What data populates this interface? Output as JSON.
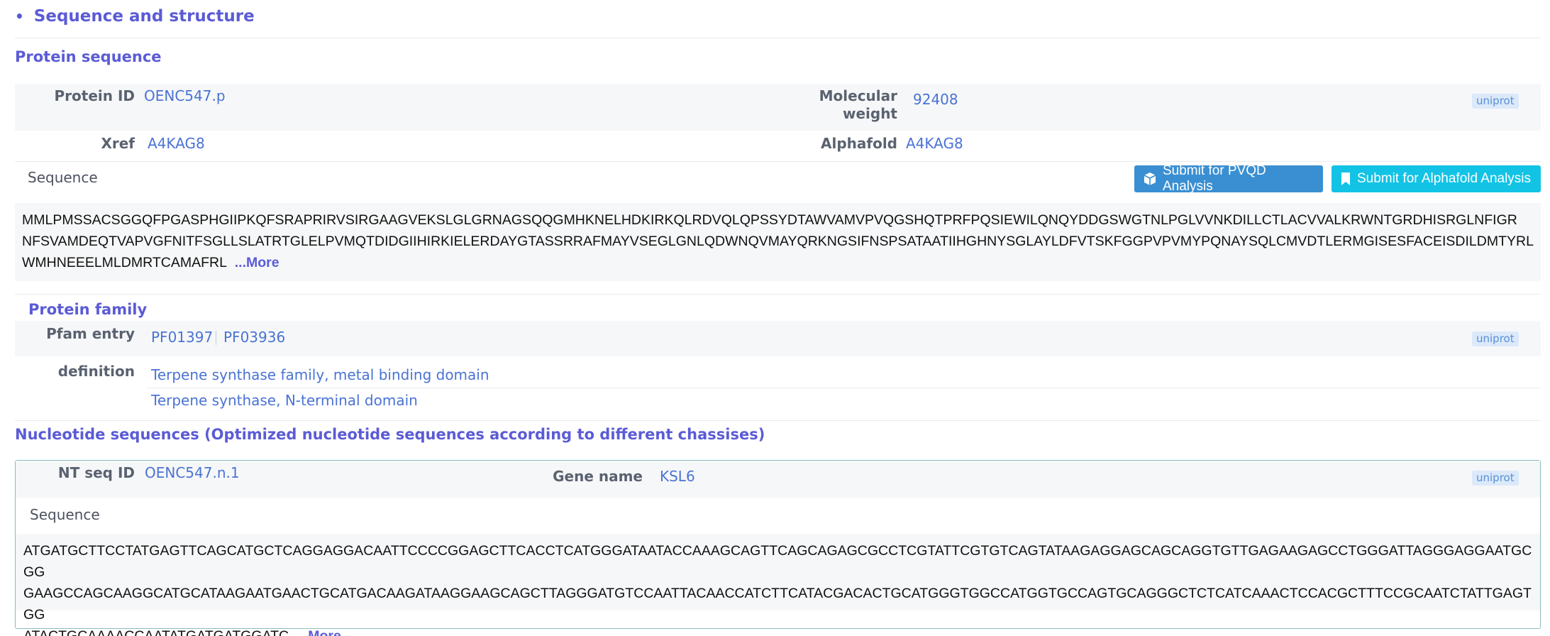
{
  "section": {
    "bullet": "•",
    "title": "Sequence and structure"
  },
  "protein_sequence": {
    "title": "Protein sequence",
    "protein_id_label": "Protein ID",
    "protein_id": "OENC547.p",
    "molecular_weight_label_1": "Molecular",
    "molecular_weight_label_2": "weight",
    "molecular_weight": "92408",
    "source_badge": "uniprot",
    "xref_label": "Xref",
    "xref": "A4KAG8",
    "alphafold_label": "Alphafold",
    "alphafold": "A4KAG8",
    "sequence_label": "Sequence",
    "submit_pvqd": "Submit for PVQD Analysis",
    "submit_alphafold": "Submit for Alphafold Analysis",
    "sequence_line_1": "MMLPMSSACSGGQFPGASPHGIIPKQFSRAPRIRVSIRGAAGVEKSLGLGRNAGSQQGMHKNELHDKIRKQLRDVQLQPSSYDTAWVAMVPVQGSHQTPRFPQSIEWILQNQYDDGSWGTNLPGLVVNKDILLCTLACVVALKRWNTGRDHISRGLNFIGR",
    "sequence_line_2": "NFSVAMDEQTVAPVGFNITFSGLLSLATRTGLELPVMQTDIDGIIHIRKIELERDAYGTASSRRAFMAYVSEGLGNLQDWNQVMAYQRKNGSIFNSPSATAATIIHGHNYSGLAYLDFVTSKFGGPVPVMYPQNAYSQLCMVDTLERMGISESFACEISDILDMTYRL",
    "sequence_line_3": "WMHNEEELMLDMRTCAMAFRL",
    "more": "...More"
  },
  "protein_family": {
    "title": "Protein family",
    "pfam_label": "Pfam entry",
    "pfam_entries": [
      "PF01397",
      "PF03936"
    ],
    "source_badge": "uniprot",
    "definition_label": "definition",
    "definitions": [
      "Terpene synthase family, metal binding domain",
      "Terpene synthase, N-terminal domain"
    ]
  },
  "nucleotide": {
    "title": "Nucleotide sequences (Optimized nucleotide sequences according to different chassises)",
    "nt_seq_id_label": "NT seq ID",
    "nt_seq_id": "OENC547.n.1",
    "gene_name_label": "Gene name",
    "gene_name": "KSL6",
    "source_badge": "uniprot",
    "sequence_label": "Sequence",
    "sequence_line_1": "ATGATGCTTCCTATGAGTTCAGCATGCTCAGGAGGACAATTCCCCGGAGCTTCACCTCATGGGATAATACCAAAGCAGTTCAGCAGAGCGCCTCGTATTCGTGTCAGTATAAGAGGAGCAGCAGGTGTTGAGAAGAGCCTGGGATTAGGGAGGAATGCGG",
    "sequence_line_2": "GAAGCCAGCAAGGCATGCATAAGAATGAACTGCATGACAAGATAAGGAAGCAGCTTAGGGATGTCCAATTACAACCATCTTCATACGACACTGCATGGGTGGCCATGGTGCCAGTGCAGGGCTCTCATCAAACTCCACGCTTTCCGCAATCTATTGAGTGG",
    "sequence_line_3": "ATACTGCAAAACCAATATGATGATGGATC",
    "more": "...More"
  },
  "colors": {
    "accent": "#5b5bd6",
    "link": "#4a73d4",
    "pvqd_button": "#3a8fd2",
    "alphafold_button": "#12c3e6",
    "nt_box_border": "#89bcbc"
  },
  "icons": {
    "pvqd_button": "cube-icon",
    "alphafold_button": "bookmark-icon"
  }
}
